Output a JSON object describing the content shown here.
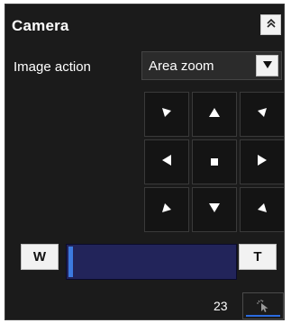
{
  "panel": {
    "title": "Camera"
  },
  "image_action": {
    "label": "Image action",
    "selected": "Area zoom"
  },
  "zoom": {
    "wide_label": "W",
    "tele_label": "T",
    "value": "23",
    "position_fraction": 0.0
  },
  "icons": {
    "collapse": "chevron-up-double-icon",
    "dropdown": "triangle-down-icon",
    "pointer": "cursor-sparkle-icon"
  },
  "colors": {
    "panel_bg": "#1b1b1b",
    "zoom_track": "#22245a",
    "accent": "#3c7ae0"
  }
}
